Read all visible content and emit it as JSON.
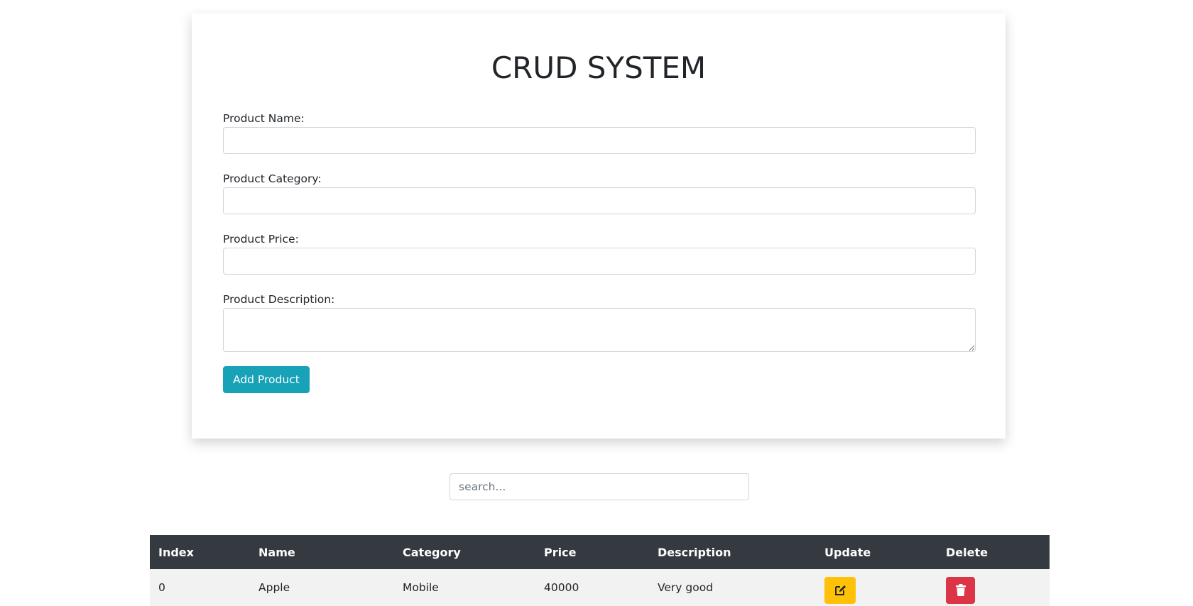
{
  "title": "CRUD SYSTEM",
  "form": {
    "name_label": "Product Name:",
    "name_value": "",
    "category_label": "Product Category:",
    "category_value": "",
    "price_label": "Product Price:",
    "price_value": "",
    "description_label": "Product Description:",
    "description_value": "",
    "add_button": "Add Product"
  },
  "search": {
    "placeholder": "search...",
    "value": ""
  },
  "table": {
    "headers": [
      "Index",
      "Name",
      "Category",
      "Price",
      "Description",
      "Update",
      "Delete"
    ],
    "rows": [
      {
        "index": "0",
        "name": "Apple",
        "category": "Mobile",
        "price": "40000",
        "description": "Very good",
        "update_icon": "edit-icon",
        "delete_icon": "trash-icon"
      }
    ]
  },
  "colors": {
    "add_button": "#17a2b8",
    "update_button": "#ffc107",
    "delete_button": "#dc3545",
    "table_header": "#343a40"
  }
}
